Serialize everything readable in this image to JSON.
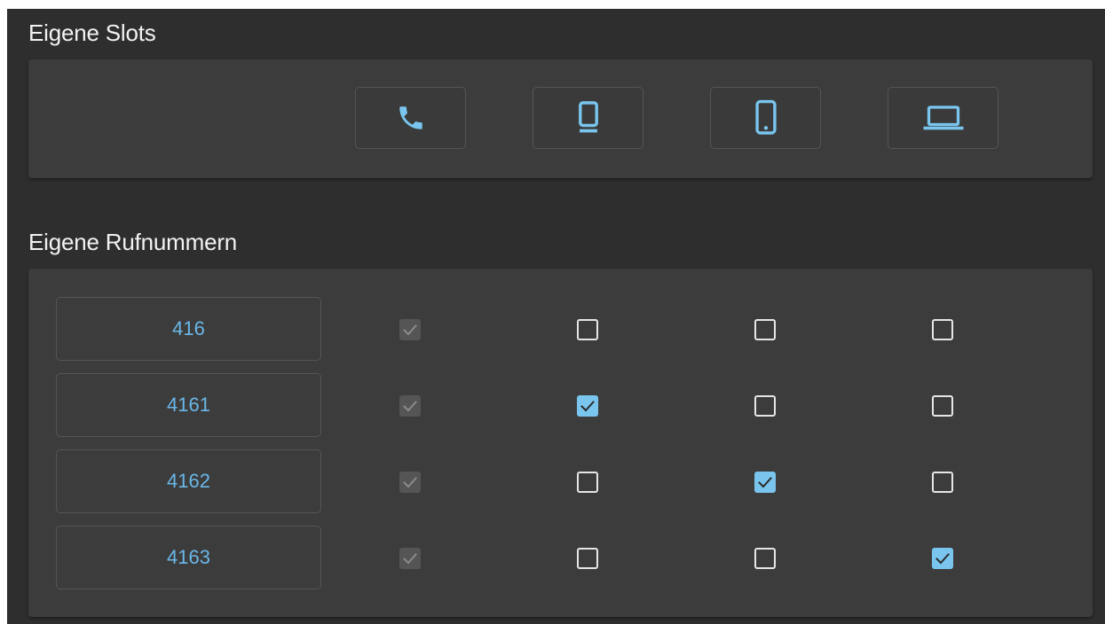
{
  "slots_section": {
    "title": "Eigene Slots",
    "slots": [
      {
        "icon": "phone-icon"
      },
      {
        "icon": "desk-phone-icon"
      },
      {
        "icon": "smartphone-icon"
      },
      {
        "icon": "laptop-icon"
      }
    ]
  },
  "numbers_section": {
    "title": "Eigene Rufnummern",
    "rows": [
      {
        "number": "416",
        "checks": [
          "disabled-checked",
          "unchecked",
          "unchecked",
          "unchecked"
        ]
      },
      {
        "number": "4161",
        "checks": [
          "disabled-checked",
          "checked",
          "unchecked",
          "unchecked"
        ]
      },
      {
        "number": "4162",
        "checks": [
          "disabled-checked",
          "unchecked",
          "checked",
          "unchecked"
        ]
      },
      {
        "number": "4163",
        "checks": [
          "disabled-checked",
          "unchecked",
          "unchecked",
          "checked"
        ]
      }
    ]
  },
  "colors": {
    "background": "#2e2e2e",
    "card": "#3c3c3c",
    "accent": "#79c5ee",
    "number_text": "#6ab7e8",
    "disabled_checkbox": "#555555"
  }
}
